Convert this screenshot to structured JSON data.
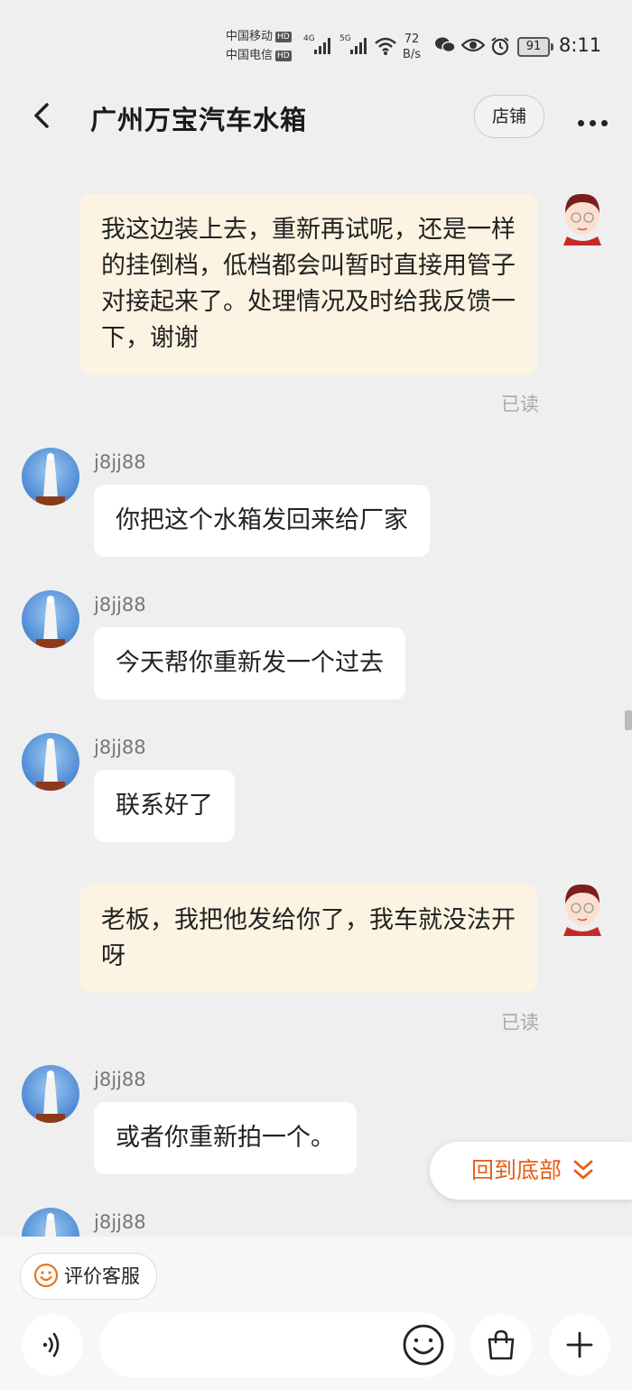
{
  "status_bar": {
    "carrier1": "中国移动",
    "carrier2": "中国电信",
    "hd_label": "HD",
    "net1": "4G",
    "net2": "5G",
    "speed_value": "72",
    "speed_unit": "B/s",
    "battery": "91",
    "time": "8:11"
  },
  "header": {
    "title": "广州万宝汽车水箱",
    "shop_button": "店铺"
  },
  "messages": [
    {
      "sender": "me",
      "text": "我这边装上去，重新再试呢，还是一样的挂倒档，低档都会叫暂时直接用管子对接起来了。处理情况及时给我反馈一下，谢谢",
      "status": "已读"
    },
    {
      "sender": "j8jj88",
      "text": "你把这个水箱发回来给厂家"
    },
    {
      "sender": "j8jj88",
      "text": "今天帮你重新发一个过去"
    },
    {
      "sender": "j8jj88",
      "text": "联系好了"
    },
    {
      "sender": "me",
      "text": "老板，我把他发给你了，我车就没法开呀",
      "status": "已读"
    },
    {
      "sender": "j8jj88",
      "text": "或者你重新拍一个。"
    },
    {
      "sender": "j8jj88",
      "text": ""
    }
  ],
  "scroll_to_bottom": "回到底部",
  "bottom_bar": {
    "rate_button": "评价客服",
    "input_placeholder": ""
  },
  "icons": [
    "back-arrow-icon",
    "more-icon",
    "voice-icon",
    "emoji-icon",
    "shopping-bag-icon",
    "plus-icon",
    "smile-face-icon",
    "double-chevron-down-icon",
    "wechat-icon",
    "eye-icon",
    "alarm-icon",
    "wifi-icon",
    "signal-icon"
  ],
  "colors": {
    "accent": "#e85d14",
    "my_bubble": "#fdf3e2",
    "background": "#efefef"
  }
}
